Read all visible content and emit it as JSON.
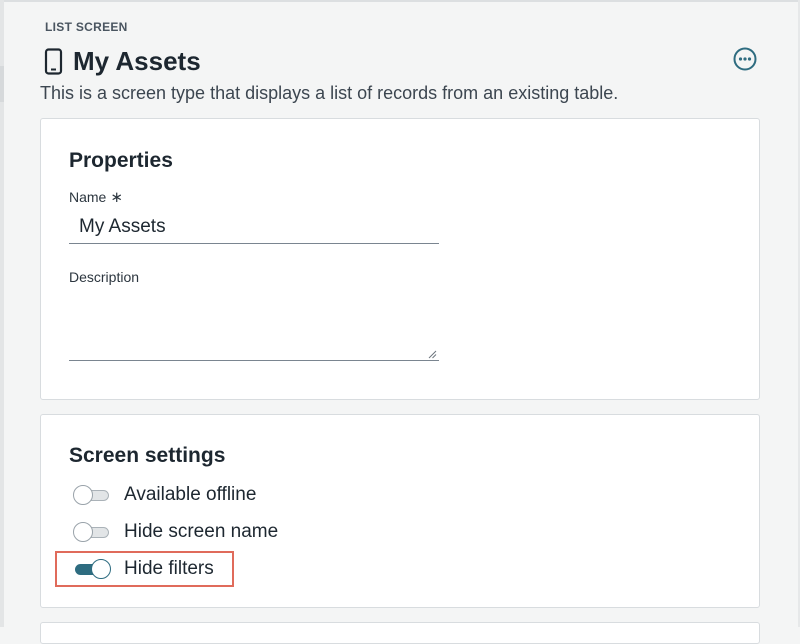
{
  "header": {
    "screen_type_label": "LIST SCREEN",
    "title": "My Assets",
    "subtitle": "This is a screen type that displays a list of records from an existing table.",
    "title_icon": "mobile-phone-icon",
    "more_icon": "more-options-icon"
  },
  "properties": {
    "section_title": "Properties",
    "name_label": "Name",
    "name_required_marker": "∗",
    "name_value": "My Assets",
    "description_label": "Description",
    "description_value": ""
  },
  "screen_settings": {
    "section_title": "Screen settings",
    "toggles": [
      {
        "label": "Available offline",
        "checked": false
      },
      {
        "label": "Hide screen name",
        "checked": false
      },
      {
        "label": "Hide filters",
        "checked": true
      }
    ]
  },
  "colors": {
    "accent": "#2e6c80",
    "highlight": "#e06b5b"
  }
}
